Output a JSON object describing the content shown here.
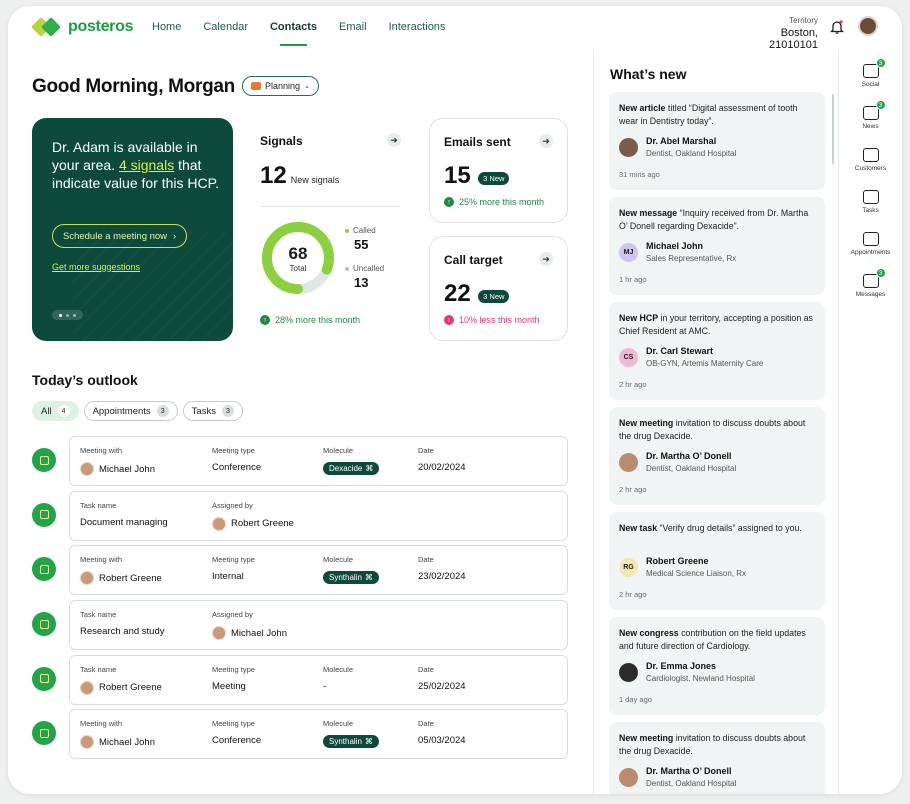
{
  "brand": {
    "name": "posteros"
  },
  "nav": {
    "items": [
      "Home",
      "Calendar",
      "Contacts",
      "Email",
      "Interactions"
    ],
    "active": "Contacts"
  },
  "territory": {
    "label": "Territory",
    "value": "Boston, 21010101"
  },
  "icons": {
    "bell": "bell-icon",
    "avatar": "user-avatar",
    "arrow": "arrow-right-icon"
  },
  "greeting": {
    "text": "Good Morning, Morgan",
    "mode": "Planning"
  },
  "hero": {
    "line1": "Dr. Adam is available in your area.",
    "signals_link": "4 signals",
    "line2": "that indicate value for this HCP.",
    "button": "Schedule a meeting now",
    "link": "Get more suggestions"
  },
  "signals": {
    "title": "Signals",
    "count": "12",
    "count_label": "New signals",
    "total": "68",
    "total_label": "Total",
    "called_label": "Called",
    "called": "55",
    "uncalled_label": "Uncalled",
    "uncalled": "13",
    "trend": "28% more this month",
    "called_fraction": 0.81,
    "colors": {
      "called": "#8ccf3f",
      "uncalled": "#e1e6e6",
      "trend_up": "#1f8a44"
    }
  },
  "emails": {
    "title": "Emails sent",
    "count": "15",
    "badge": "3 New",
    "trend": "25% more this month"
  },
  "calls": {
    "title": "Call target",
    "count": "22",
    "badge": "3 New",
    "trend": "10% less this month",
    "trend_color": "#e03a77"
  },
  "outlook": {
    "title": "Today’s outlook",
    "filters": [
      {
        "label": "All",
        "count": "4",
        "active": true
      },
      {
        "label": "Appointments",
        "count": "3"
      },
      {
        "label": "Tasks",
        "count": "3"
      }
    ],
    "rows": [
      {
        "type": "meeting",
        "c1_label": "Meeting with",
        "c1": "Michael John",
        "c2_label": "Meeting type",
        "c2": "Conference",
        "c3_label": "Molecule",
        "c3": "Dexacide",
        "c4_label": "Date",
        "c4": "20/02/2024"
      },
      {
        "type": "task",
        "c1_label": "Task name",
        "c1": "Document managing",
        "c2_label": "Assigned by",
        "c2": "Robert Greene"
      },
      {
        "type": "meeting",
        "c1_label": "Meeting with",
        "c1": "Robert Greene",
        "c2_label": "Meeting type",
        "c2": "Internal",
        "c3_label": "Molecule",
        "c3": "Synthalin",
        "c4_label": "Date",
        "c4": "23/02/2024"
      },
      {
        "type": "task",
        "c1_label": "Task name",
        "c1": "Research and study",
        "c2_label": "Assigned by",
        "c2": "Michael John"
      },
      {
        "type": "meeting",
        "c1_label": "Task name",
        "c1": "Robert Greene",
        "c2_label": "Meeting type",
        "c2": "Meeting",
        "c3_label": "Molecule",
        "c3": "-",
        "c3_plain": true,
        "c4_label": "Date",
        "c4": "25/02/2024"
      },
      {
        "type": "meeting",
        "c1_label": "Meeting with",
        "c1": "Michael John",
        "c2_label": "Meeting type",
        "c2": "Conference",
        "c3_label": "Molecule",
        "c3": "Synthalin",
        "c4_label": "Date",
        "c4": "05/03/2024"
      }
    ]
  },
  "feed": {
    "title": "What’s new",
    "items": [
      {
        "bold": "New article",
        "text": " titled “Digital assessment of tooth wear in Dentistry today”.",
        "name": "Dr. Abel Marshal",
        "role": "Dentist, Oakland Hospital",
        "time": "31 mins ago",
        "initials": "",
        "av": "#7a5c4a"
      },
      {
        "bold": "New message",
        "text": " “Inquiry received from Dr. Martha O’ Donell regarding Dexacide”.",
        "name": "Michael John",
        "role": "Sales Representative, Rx",
        "time": "1 hr ago",
        "initials": "MJ",
        "av": "#cfc3f0"
      },
      {
        "bold": "New HCP",
        "text": " in your territory, accepting a position as Chief Resident at AMC.",
        "name": "Dr. Carl Stewart",
        "role": "OB-GYN, Artemis Maternity Care",
        "time": "2 hr ago",
        "initials": "CS",
        "av": "#f3b6d6"
      },
      {
        "bold": "New meeting",
        "text": " invitation to discuss doubts about the drug Dexacide.",
        "name": "Dr. Martha O’ Donell",
        "role": "Dentist, Oakland Hospital",
        "time": "2 hr ago",
        "initials": "",
        "av": "#b98c6e"
      },
      {
        "bold": "New task",
        "text": " “Verify drug details” assigned to you.",
        "name": "Robert Greene",
        "role": "Medical Science Liaison, Rx",
        "time": "2 hr ago",
        "initials": "RG",
        "av": "#f3e7b0"
      },
      {
        "bold": "New congress",
        "text": " contribution on the field updates and future direction of Cardiology.",
        "name": "Dr. Emma Jones",
        "role": "Cardiologist, Newland Hospital",
        "time": "1 day ago",
        "initials": "",
        "av": "#2b2b2b"
      },
      {
        "bold": "New meeting",
        "text": " invitation to discuss doubts about the drug Dexacide.",
        "name": "Dr. Martha O’ Donell",
        "role": "Dentist, Oakland Hospital",
        "time": "",
        "initials": "",
        "av": "#b98c6e"
      }
    ]
  },
  "rail": [
    {
      "label": "Social",
      "badge": "3"
    },
    {
      "label": "News",
      "badge": "3"
    },
    {
      "label": "Customers",
      "badge": ""
    },
    {
      "label": "Tasks",
      "badge": ""
    },
    {
      "label": "Appointments",
      "badge": ""
    },
    {
      "label": "Messages",
      "badge": "3"
    }
  ]
}
